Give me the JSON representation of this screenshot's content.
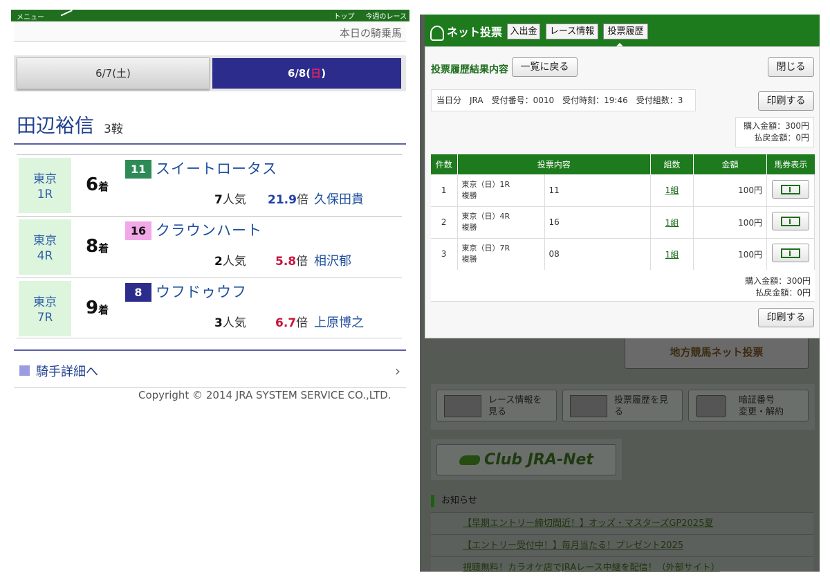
{
  "left": {
    "topbar": {
      "menu": "メニュー",
      "nav": [
        "トップ",
        "今週のレース"
      ]
    },
    "subhead": "本日の騎乗馬",
    "dates": {
      "tab1": "6/7(土)",
      "tab2_prefix": "6/8(",
      "tab2_day": "日",
      "tab2_suffix": ")"
    },
    "jockey": {
      "name": "田辺裕信",
      "rides": "3鞍"
    },
    "races": [
      {
        "venue": "東京",
        "race": "1R",
        "finish_num": "6",
        "finish_suffix": "着",
        "horse_num": "11",
        "horse_num_bg": "#2e8b57",
        "horse_num_fg": "#ffffff",
        "horse": "スイートロータス",
        "pop_num": "7",
        "pop_suffix": "人気",
        "odds": "21.9",
        "odds_suffix": "倍",
        "odds_color": "#1f3fa8",
        "jockey": "久保田貴"
      },
      {
        "venue": "東京",
        "race": "4R",
        "finish_num": "8",
        "finish_suffix": "着",
        "horse_num": "16",
        "horse_num_bg": "#f2a8e8",
        "horse_num_fg": "#111111",
        "horse": "クラウンハート",
        "pop_num": "2",
        "pop_suffix": "人気",
        "odds": "5.8",
        "odds_suffix": "倍",
        "odds_color": "#c8143c",
        "jockey": "相沢郁"
      },
      {
        "venue": "東京",
        "race": "7R",
        "finish_num": "9",
        "finish_suffix": "着",
        "horse_num": "8",
        "horse_num_bg": "#2b2c8c",
        "horse_num_fg": "#ffffff",
        "horse": "ウフドゥウフ",
        "pop_num": "3",
        "pop_suffix": "人気",
        "odds": "6.7",
        "odds_suffix": "倍",
        "odds_color": "#c8143c",
        "jockey": "上原博之"
      }
    ],
    "detail_link": "騎手詳細へ",
    "copyright": "Copyright © 2014 JRA SYSTEM SERVICE CO.,LTD."
  },
  "right": {
    "header": {
      "brand": "ネット投票",
      "buttons": [
        "入出金",
        "レース情報",
        "投票履歴"
      ]
    },
    "modal": {
      "title": "投票履歴結果内容",
      "back_button": "一覧に戻る",
      "close_button": "閉じる",
      "info": "当日分　JRA　受付番号：0010　受付時刻：19:46　受付組数：3",
      "print_button": "印刷する",
      "purchase_total": "購入金額：300円",
      "refund_total": "払戻金額：0円",
      "columns": [
        "件数",
        "投票内容",
        "組数",
        "金額",
        "馬券表示"
      ],
      "rows": [
        {
          "no": "1",
          "race": "東京（日）1R",
          "type": "複勝",
          "horse": "11",
          "sets": "1組",
          "amount": "100円"
        },
        {
          "no": "2",
          "race": "東京（日）4R",
          "type": "複勝",
          "horse": "16",
          "sets": "1組",
          "amount": "100円"
        },
        {
          "no": "3",
          "race": "東京（日）7R",
          "type": "複勝",
          "horse": "08",
          "sets": "1組",
          "amount": "100円"
        }
      ]
    },
    "background": {
      "chiho_button": "地方競馬ネット投票",
      "cards": [
        {
          "line1": "レース情報を",
          "line2": "見る"
        },
        {
          "line1": "投票履歴を見",
          "line2": "る"
        },
        {
          "line1": "暗証番号",
          "line2": "変更・解約"
        }
      ],
      "club_button": "Club JRA-Net",
      "notice_heading": "お知らせ",
      "notices": [
        "【早期エントリー締切間近！】オッズ・マスターズGP2025夏",
        "【エントリー受付中！】毎月当たる！プレゼント2025",
        "視聴無料！カラオケ店でJRAレース中継を配信！（外部サイト）"
      ]
    }
  }
}
